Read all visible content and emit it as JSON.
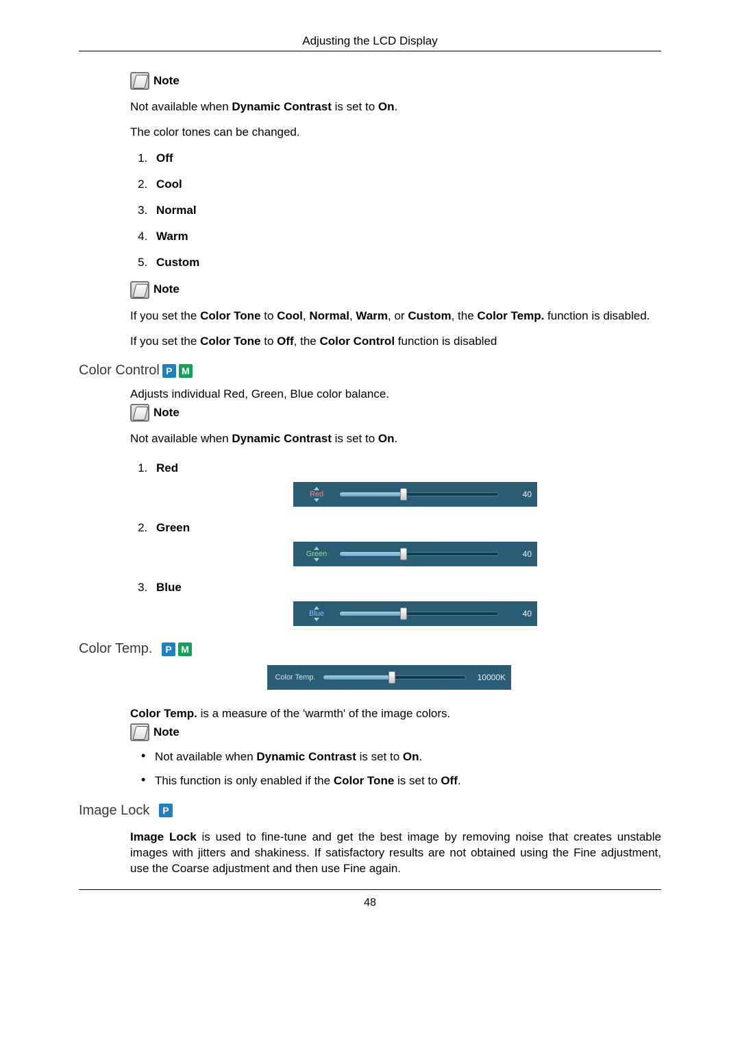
{
  "header": "Adjusting the LCD Display",
  "page_number": "48",
  "note_label": "Note",
  "section1": {
    "para1_a": "Not available when ",
    "para1_b": "Dynamic Contrast",
    "para1_c": " is set to ",
    "para1_d": "On",
    "para1_e": ".",
    "para2": "The color tones can be changed.",
    "options": [
      "Off",
      "Cool",
      "Normal",
      "Warm",
      "Custom"
    ],
    "para3_a": "If you set the ",
    "para3_b": "Color Tone",
    "para3_c": " to ",
    "para3_d": "Cool",
    "para3_e": ", ",
    "para3_f": "Normal",
    "para3_g": ", ",
    "para3_h": "Warm",
    "para3_i": ", or ",
    "para3_j": "Custom",
    "para3_k": ", the ",
    "para3_l": "Color Temp.",
    "para3_m": " function is disabled.",
    "para4_a": "If you set the ",
    "para4_b": "Color Tone",
    "para4_c": " to ",
    "para4_d": "Off",
    "para4_e": ", the ",
    "para4_f": "Color Control",
    "para4_g": " function is disabled"
  },
  "color_control": {
    "title": "Color Control",
    "intro": "Adjusts individual Red, Green, Blue color balance.",
    "note1_a": "Not available when ",
    "note1_b": "Dynamic Contrast",
    "note1_c": " is set to ",
    "note1_d": "On",
    "note1_e": ".",
    "items": [
      {
        "label": "Red",
        "slider_label": "Red",
        "value": "40",
        "pct": 40
      },
      {
        "label": "Green",
        "slider_label": "Green",
        "value": "40",
        "pct": 40
      },
      {
        "label": "Blue",
        "slider_label": "Blue",
        "value": "40",
        "pct": 40
      }
    ]
  },
  "color_temp": {
    "title": "Color Temp.",
    "slider_label": "Color Temp.",
    "value": "10000K",
    "pct": 48,
    "para1_a": "Color Temp.",
    "para1_b": " is a measure of the 'warmth' of the image colors.",
    "bullet1_a": "Not available when ",
    "bullet1_b": "Dynamic Contrast",
    "bullet1_c": " is set to ",
    "bullet1_d": "On",
    "bullet1_e": ".",
    "bullet2_a": "This function is only enabled if the ",
    "bullet2_b": "Color Tone",
    "bullet2_c": " is set to ",
    "bullet2_d": "Off",
    "bullet2_e": "."
  },
  "image_lock": {
    "title": "Image Lock",
    "para_a": "Image Lock",
    "para_b": " is used to fine-tune and get the best image by removing noise that creates unstable images with jitters and shakiness. If satisfactory results are not obtained using the Fine adjustment, use the Coarse adjustment and then use Fine again."
  },
  "tags": {
    "p": "P",
    "m": "M"
  }
}
